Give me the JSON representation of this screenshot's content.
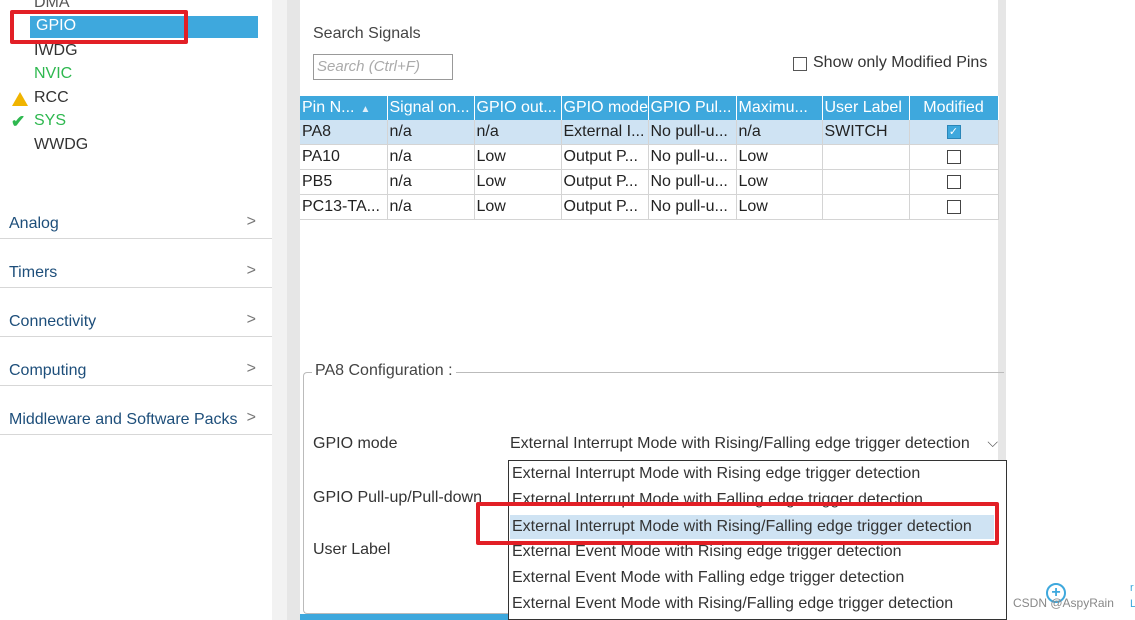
{
  "sidebar": {
    "system_items": [
      {
        "label": "DMA"
      },
      {
        "label": "GPIO"
      },
      {
        "label": "IWDG"
      },
      {
        "label": "NVIC"
      },
      {
        "label": "RCC"
      },
      {
        "label": "SYS"
      },
      {
        "label": "WWDG"
      }
    ],
    "categories": [
      {
        "label": "Analog"
      },
      {
        "label": "Timers"
      },
      {
        "label": "Connectivity"
      },
      {
        "label": "Computing"
      },
      {
        "label": "Middleware and Software Packs"
      }
    ]
  },
  "main": {
    "search_title": "Search Signals",
    "search_placeholder": "Search (Ctrl+F)",
    "show_modified_label": "Show only Modified Pins",
    "table": {
      "columns": [
        "Pin N...",
        "Signal on...",
        "GPIO out...",
        "GPIO mode",
        "GPIO Pul...",
        "Maximu...",
        "User Label",
        "Modified"
      ],
      "rows": [
        [
          "PA8",
          "n/a",
          "n/a",
          "External I...",
          "No pull-u...",
          "n/a",
          "SWITCH",
          true
        ],
        [
          "PA10",
          "n/a",
          "Low",
          "Output P...",
          "No pull-u...",
          "Low",
          "",
          false
        ],
        [
          "PB5",
          "n/a",
          "Low",
          "Output P...",
          "No pull-u...",
          "Low",
          "",
          false
        ],
        [
          "PC13-TA...",
          "n/a",
          "Low",
          "Output P...",
          "No pull-u...",
          "Low",
          "",
          false
        ]
      ]
    },
    "config": {
      "title": "PA8 Configuration :",
      "gpio_mode_label": "GPIO mode",
      "pull_label": "GPIO Pull-up/Pull-down",
      "user_label_label": "User Label",
      "gpio_mode_value": "External Interrupt Mode with Rising/Falling edge trigger detection",
      "options": [
        "External Interrupt Mode with Rising edge trigger detection",
        "External Interrupt Mode with Falling edge trigger detection",
        "External Interrupt Mode with Rising/Falling edge trigger detection",
        "External Event Mode with Rising edge trigger detection",
        "External Event Mode with Falling edge trigger detection",
        "External Event Mode with Rising/Falling edge trigger detection"
      ]
    }
  },
  "watermark": "CSDN @AspyRain",
  "colors": {
    "accent": "#3ea8dd",
    "highlight_red": "#e21f26",
    "status_green": "#2eb84f",
    "warning_yellow": "#f0b400"
  }
}
